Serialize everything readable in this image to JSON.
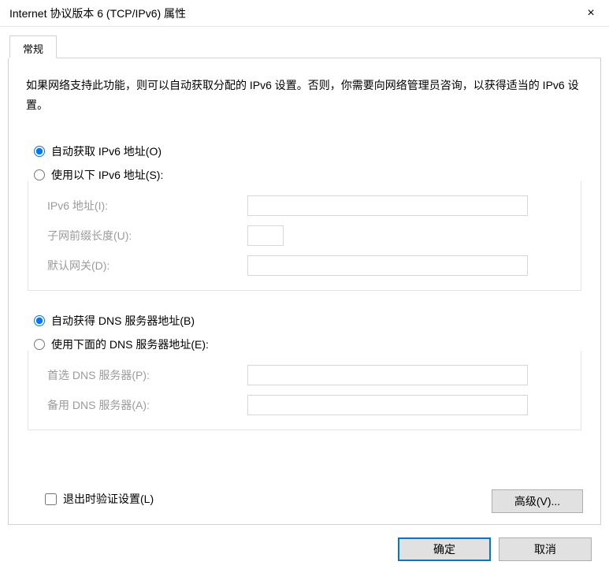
{
  "window": {
    "title": "Internet 协议版本 6 (TCP/IPv6) 属性",
    "close_icon": "×"
  },
  "tabs": {
    "general": "常规"
  },
  "info": "如果网络支持此功能，则可以自动获取分配的 IPv6 设置。否则，你需要向网络管理员咨询，以获得适当的 IPv6 设置。",
  "addr_section": {
    "auto_label": "自动获取 IPv6 地址(O)",
    "manual_label": "使用以下 IPv6 地址(S):",
    "auto_selected": true,
    "ipv6_label": "IPv6 地址(I):",
    "ipv6_value": "",
    "prefix_label": "子网前缀长度(U):",
    "prefix_value": "",
    "gateway_label": "默认网关(D):",
    "gateway_value": ""
  },
  "dns_section": {
    "auto_label": "自动获得 DNS 服务器地址(B)",
    "manual_label": "使用下面的 DNS 服务器地址(E):",
    "auto_selected": true,
    "preferred_label": "首选 DNS 服务器(P):",
    "preferred_value": "",
    "alternate_label": "备用 DNS 服务器(A):",
    "alternate_value": ""
  },
  "validate_label": "退出时验证设置(L)",
  "validate_checked": false,
  "advanced_label": "高级(V)...",
  "buttons": {
    "ok": "确定",
    "cancel": "取消"
  }
}
